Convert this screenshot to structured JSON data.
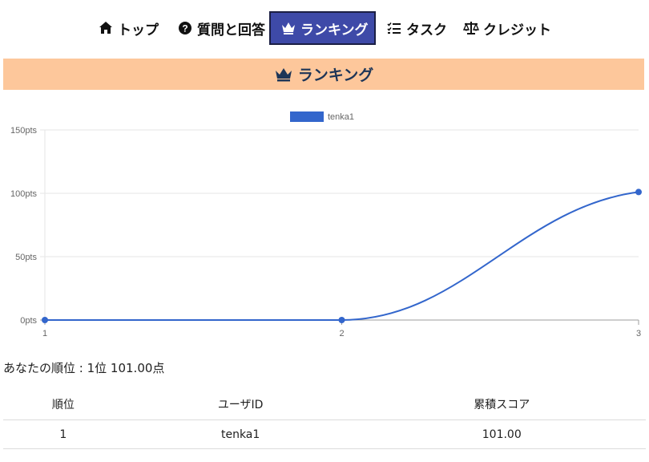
{
  "nav": {
    "items": [
      {
        "label": "トップ",
        "icon": "home-icon"
      },
      {
        "label": "質問と回答",
        "icon": "question-circle-icon"
      },
      {
        "label": "ランキング",
        "icon": "crown-icon",
        "active": true
      },
      {
        "label": "タスク",
        "icon": "list-check-icon"
      },
      {
        "label": "クレジット",
        "icon": "scale-icon"
      }
    ]
  },
  "banner": {
    "title": "ランキング",
    "icon": "crown-icon",
    "bg": "#fdc79b"
  },
  "chart_data": {
    "type": "line",
    "x": [
      "1",
      "2",
      "3"
    ],
    "series": [
      {
        "name": "tenka1",
        "values": [
          0,
          0,
          101
        ],
        "color": "#3366cc"
      }
    ],
    "yticks": [
      "0pts",
      "50pts",
      "100pts",
      "150pts"
    ],
    "ylim": [
      0,
      150
    ],
    "grid": true,
    "legend": "top"
  },
  "rank": {
    "prefix": "あなたの順位 : ",
    "position": "1位",
    "score": "101.00点"
  },
  "table": {
    "headers": [
      "順位",
      "ユーザID",
      "累積スコア"
    ],
    "rows": [
      [
        "1",
        "tenka1",
        "101.00"
      ]
    ]
  },
  "colors": {
    "accent": "#3e4aa8",
    "line": "#3366cc"
  }
}
